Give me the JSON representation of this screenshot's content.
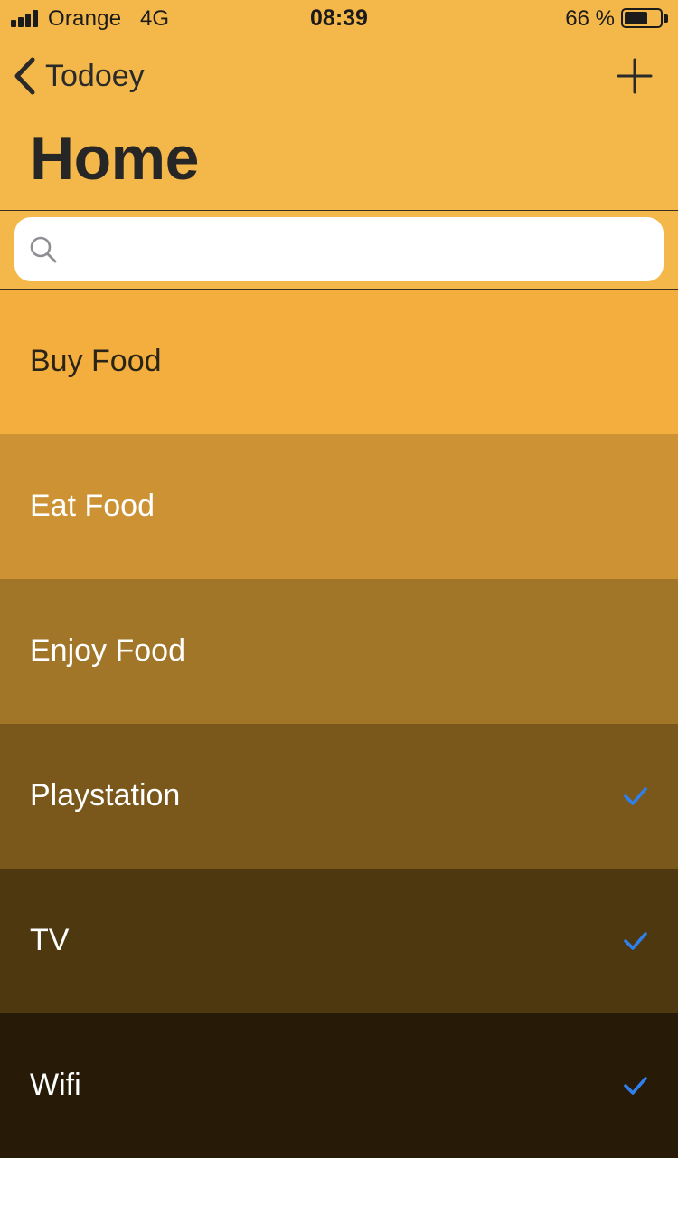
{
  "status_bar": {
    "carrier": "Orange",
    "network": "4G",
    "time": "08:39",
    "battery_percent": "66 %",
    "battery_level": 0.66
  },
  "nav": {
    "back_label": "Todoey",
    "back_icon": "chevron-left-icon",
    "add_icon": "plus-icon"
  },
  "title": "Home",
  "search": {
    "placeholder": "",
    "value": "",
    "icon": "search-icon"
  },
  "colors": {
    "header_bg": "#F4B84A",
    "check_color": "#2F80ED"
  },
  "items": [
    {
      "label": "Buy Food",
      "done": false,
      "bg": "#F4AE3E",
      "text_color": "#2b2518"
    },
    {
      "label": "Eat Food",
      "done": false,
      "bg": "#CC9233",
      "text_color": "#ffffff"
    },
    {
      "label": "Enjoy Food",
      "done": false,
      "bg": "#A27628",
      "text_color": "#ffffff"
    },
    {
      "label": "Playstation",
      "done": true,
      "bg": "#7A571B",
      "text_color": "#ffffff"
    },
    {
      "label": "TV",
      "done": true,
      "bg": "#4E3810",
      "text_color": "#ffffff"
    },
    {
      "label": "Wifi",
      "done": true,
      "bg": "#271B07",
      "text_color": "#ffffff"
    }
  ]
}
